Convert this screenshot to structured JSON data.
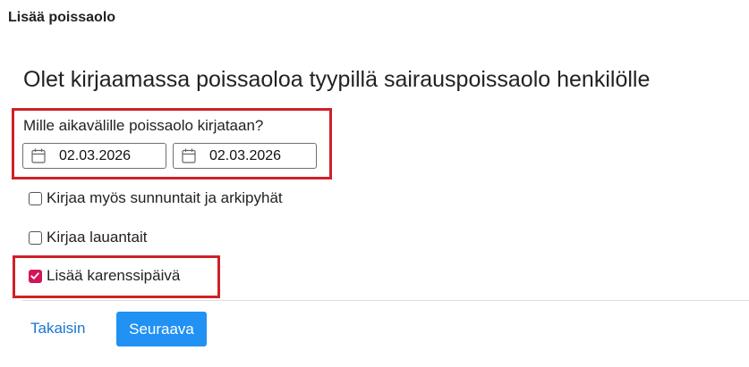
{
  "dialog": {
    "title": "Lisää poissaolo",
    "headline": "Olet kirjaamassa poissaoloa tyypillä sairauspoissaolo henkilölle"
  },
  "date_range": {
    "question": "Mille aikavälille poissaolo kirjataan?",
    "start_date": "02.03.2026",
    "end_date": "02.03.2026"
  },
  "options": {
    "include_sundays": {
      "label": "Kirjaa myös sunnuntait ja arkipyhät",
      "checked": false
    },
    "include_saturdays": {
      "label": "Kirjaa lauantait",
      "checked": false
    },
    "add_waiting_day": {
      "label": "Lisää karenssipäivä",
      "checked": true
    }
  },
  "actions": {
    "back_label": "Takaisin",
    "next_label": "Seuraava"
  },
  "colors": {
    "highlight": "#d0202a",
    "primary": "#2191f3",
    "link": "#1976d2",
    "checkbox_checked": "#d4145a"
  },
  "icons": {
    "date_icon": "calendar-icon",
    "check_icon": "checkmark-icon"
  }
}
